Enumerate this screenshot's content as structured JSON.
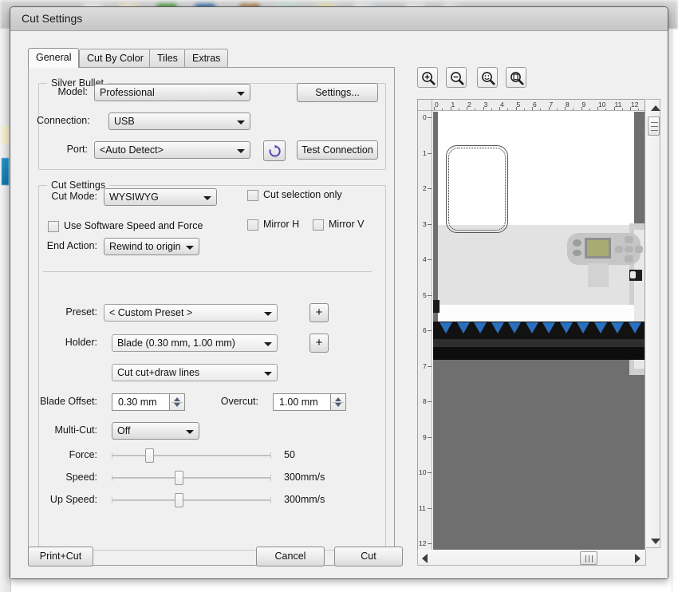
{
  "window": {
    "title": "Cut Settings"
  },
  "tabs": [
    {
      "label": "General",
      "active": true
    },
    {
      "label": "Cut By Color",
      "active": false
    },
    {
      "label": "Tiles",
      "active": false
    },
    {
      "label": "Extras",
      "active": false
    }
  ],
  "silver_bullet": {
    "legend": "Silver Bullet",
    "model_label": "Model:",
    "model_value": "Professional",
    "settings_button": "Settings...",
    "connection_label": "Connection:",
    "connection_value": "USB",
    "port_label": "Port:",
    "port_value": "<Auto Detect>",
    "refresh_icon": "refresh-icon",
    "test_connection_button": "Test Connection"
  },
  "cut_settings": {
    "legend": "Cut Settings",
    "cut_mode_label": "Cut Mode:",
    "cut_mode_value": "WYSIWYG",
    "use_software_speed_force_label": "Use Software Speed and Force",
    "use_software_speed_force_checked": false,
    "end_action_label": "End Action:",
    "end_action_value": "Rewind to origin",
    "cut_selection_only_label": "Cut selection only",
    "cut_selection_only_checked": false,
    "mirror_h_label": "Mirror H",
    "mirror_h_checked": false,
    "mirror_v_label": "Mirror V",
    "mirror_v_checked": false,
    "preset_label": "Preset:",
    "preset_value": "< Custom Preset >",
    "preset_add_button": "+",
    "holder_label": "Holder:",
    "holder_value": "Blade (0.30 mm, 1.00 mm)",
    "holder_add_button": "+",
    "line_mode_value": "Cut cut+draw lines",
    "blade_offset_label": "Blade Offset:",
    "blade_offset_value": "0.30 mm",
    "overcut_label": "Overcut:",
    "overcut_value": "1.00 mm",
    "multi_cut_label": "Multi-Cut:",
    "multi_cut_value": "Off",
    "force_label": "Force:",
    "force_value": "50",
    "force_percent": 22,
    "speed_label": "Speed:",
    "speed_value": "300mm/s",
    "speed_percent": 42,
    "up_speed_label": "Up Speed:",
    "up_speed_value": "300mm/s",
    "up_speed_percent": 42
  },
  "footer": {
    "print_cut_button": "Print+Cut",
    "cancel_button": "Cancel",
    "cut_button": "Cut"
  },
  "preview": {
    "zoom_in_icon": "zoom-in-icon",
    "zoom_out_icon": "zoom-out-icon",
    "zoom_selection_icon": "zoom-to-selection-icon",
    "zoom_fit_page_icon": "zoom-fit-page-icon",
    "ruler_units_h": [
      "0",
      "1",
      "2",
      "3",
      "4",
      "5",
      "6",
      "7",
      "8",
      "9",
      "10",
      "11",
      "12"
    ],
    "ruler_units_v": [
      "0",
      "1",
      "2",
      "3",
      "4",
      "5",
      "6",
      "7",
      "8",
      "9",
      "10",
      "11",
      "12"
    ],
    "scroll_up_icon": "scroll-up-arrow-icon",
    "scroll_down_icon": "scroll-down-arrow-icon",
    "scroll_left_icon": "scroll-left-arrow-icon",
    "scroll_right_icon": "scroll-right-arrow-icon"
  },
  "colors": {
    "dialog_bg": "#f0f0f0",
    "roller_blue": "#2a6fbd",
    "lcd_olive": "#a8ab72",
    "canvas_gray": "#6f6f6f",
    "accent_blue": "#2390c8"
  }
}
